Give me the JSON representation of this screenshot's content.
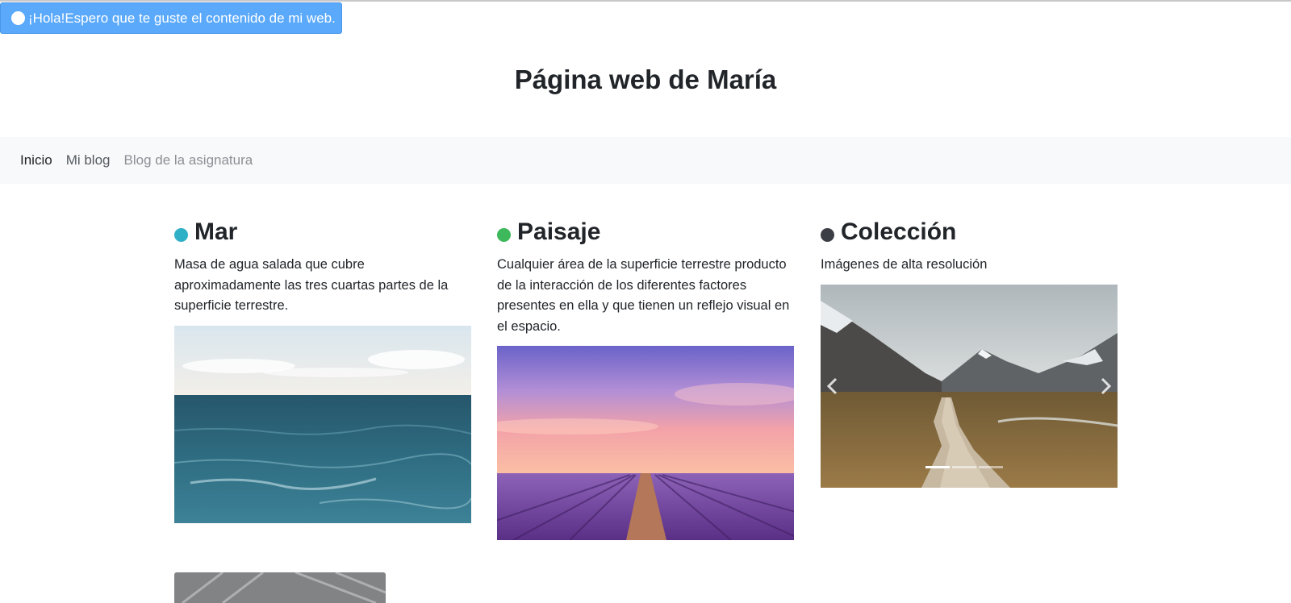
{
  "alert": {
    "icon": "circle-icon",
    "text": "¡Hola!Espero que te guste el contenido de mi web."
  },
  "header": {
    "title": "Página web de María"
  },
  "nav": {
    "items": [
      {
        "label": "Inicio"
      },
      {
        "label": "Mi blog"
      },
      {
        "label": "Blog de la asignatura"
      }
    ]
  },
  "sections": [
    {
      "title": "Mar",
      "bullet_color": "#30b0c7",
      "description": "Masa de agua salada que cubre aproximadamente las tres cuartas partes de la superficie terrestre.",
      "image": "ocean-photo"
    },
    {
      "title": "Paisaje",
      "bullet_color": "#3db85a",
      "description": "Cualquier área de la superficie terrestre producto de la interacción de los diferentes factores presentes en ella y que tienen un reflejo visual en el espacio.",
      "image": "lavender-field-sunset-photo"
    },
    {
      "title": "Colección",
      "bullet_color": "#3b3f45",
      "description": "Imágenes de alta resolución",
      "image": "mountain-boardwalk-photo"
    }
  ],
  "carousel": {
    "slides": 3,
    "active_slide": 1,
    "prev_icon": "chevron-left-icon",
    "next_icon": "chevron-right-icon"
  },
  "colors": {
    "alert_bg": "#5aa9fb",
    "navbar_bg": "#f8f9fa",
    "text": "#212529"
  }
}
